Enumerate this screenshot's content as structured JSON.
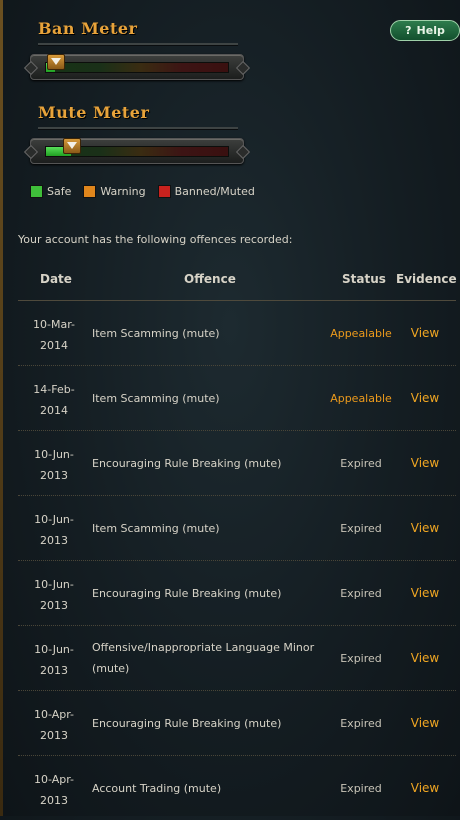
{
  "meters": [
    {
      "title": "Ban Meter",
      "level": 0.05
    },
    {
      "title": "Mute Meter",
      "level": 0.14
    }
  ],
  "help": {
    "label": "Help",
    "icon": "question-icon"
  },
  "legend": [
    {
      "label": "Safe",
      "color": "#3fbf3a"
    },
    {
      "label": "Warning",
      "color": "#e0861c"
    },
    {
      "label": "Banned/Muted",
      "color": "#c8221e"
    }
  ],
  "intro_text": "Your account has the following offences recorded:",
  "table": {
    "headers": {
      "date": "Date",
      "offence": "Offence",
      "status": "Status",
      "evidence": "Evidence"
    },
    "rows": [
      {
        "date_line1": "10-Mar-",
        "date_line2": "2014",
        "offence": "Item Scamming (mute)",
        "status": "Appealable",
        "evidence": "View"
      },
      {
        "date_line1": "14-Feb-",
        "date_line2": "2014",
        "offence": "Item Scamming (mute)",
        "status": "Appealable",
        "evidence": "View"
      },
      {
        "date_line1": "10-Jun-",
        "date_line2": "2013",
        "offence": "Encouraging Rule Breaking (mute)",
        "status": "Expired",
        "evidence": "View"
      },
      {
        "date_line1": "10-Jun-",
        "date_line2": "2013",
        "offence": "Item Scamming (mute)",
        "status": "Expired",
        "evidence": "View"
      },
      {
        "date_line1": "10-Jun-",
        "date_line2": "2013",
        "offence": "Encouraging Rule Breaking (mute)",
        "status": "Expired",
        "evidence": "View"
      },
      {
        "date_line1": "10-Jun-",
        "date_line2": "2013",
        "offence": "Offensive/Inappropriate Language Minor (mute)",
        "status": "Expired",
        "evidence": "View"
      },
      {
        "date_line1": "10-Apr-",
        "date_line2": "2013",
        "offence": "Encouraging Rule Breaking (mute)",
        "status": "Expired",
        "evidence": "View"
      },
      {
        "date_line1": "10-Apr-",
        "date_line2": "2013",
        "offence": "Account Trading (mute)",
        "status": "Expired",
        "evidence": "View"
      }
    ]
  }
}
